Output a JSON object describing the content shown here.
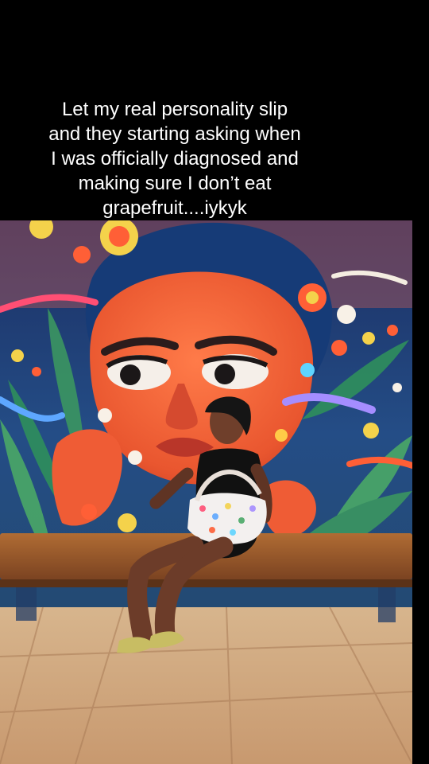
{
  "caption": {
    "lines": [
      "Let my real personality slip",
      "and they starting asking when",
      "I was officially diagnosed and",
      "making sure I don’t eat",
      "grapefruit....iykyk"
    ]
  },
  "photo": {
    "subject": "woman seated on a wooden bench in front of a colorful mural",
    "colors": {
      "mural_bg": "#1f3b73",
      "mural_face": "#f06a3c",
      "bench": "#9b5a2c",
      "floor": "#d9b48d",
      "shirt": "#111111"
    }
  }
}
